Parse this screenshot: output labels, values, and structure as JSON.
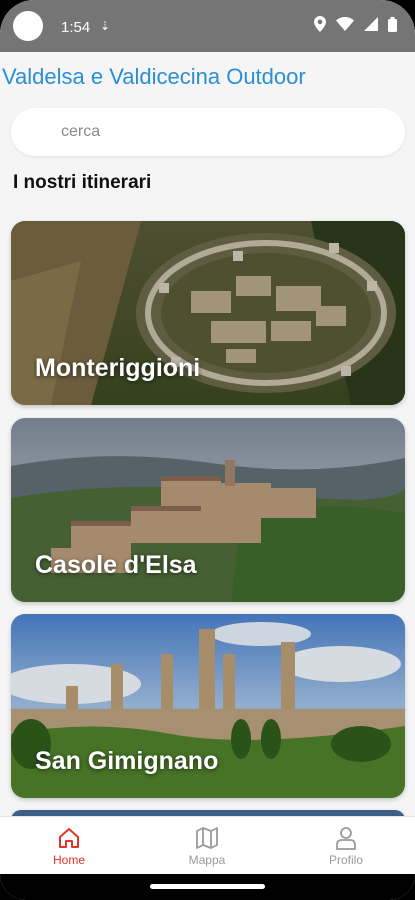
{
  "status_bar": {
    "time": "1:54",
    "icons": [
      "download-icon",
      "location-icon",
      "wifi-icon",
      "signal-icon",
      "battery-icon"
    ]
  },
  "app": {
    "title": "Valdelsa e Valdicecina Outdoor",
    "accent_color": "#2b8fd4"
  },
  "search": {
    "placeholder": "cerca",
    "value": ""
  },
  "section": {
    "title": "I nostri itinerari"
  },
  "itineraries": [
    {
      "label": "Monteriggioni"
    },
    {
      "label": "Casole d'Elsa"
    },
    {
      "label": "San Gimignano"
    }
  ],
  "bottom_nav": {
    "active_color": "#e1352b",
    "items": [
      {
        "label": "Home",
        "icon": "home-icon",
        "active": true
      },
      {
        "label": "Mappa",
        "icon": "map-icon",
        "active": false
      },
      {
        "label": "Profilo",
        "icon": "profile-icon",
        "active": false
      }
    ]
  }
}
